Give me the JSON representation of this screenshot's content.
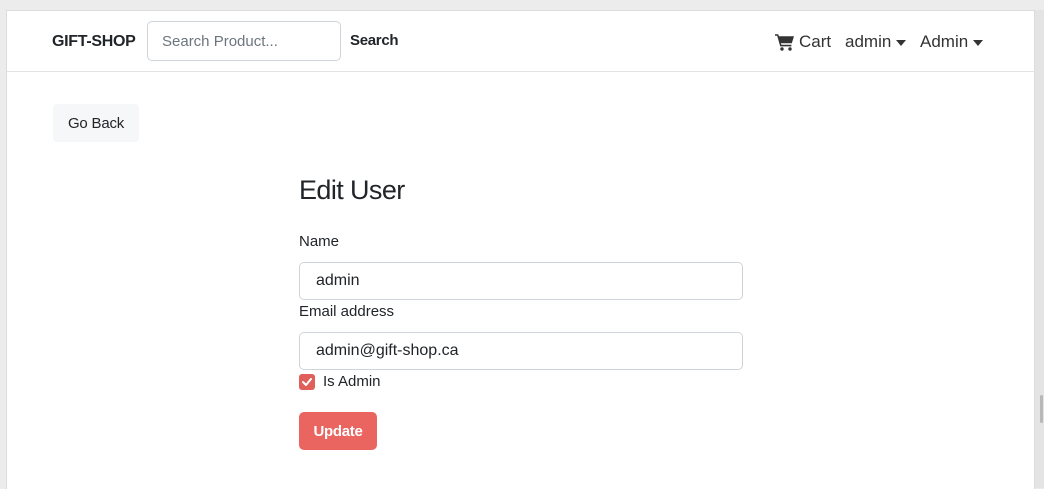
{
  "navbar": {
    "brand": "GIFT-SHOP",
    "search_placeholder": "Search Product...",
    "search_button": "Search",
    "cart_label": "Cart",
    "user_menu": "admin",
    "admin_menu": "Admin"
  },
  "go_back": "Go Back",
  "form": {
    "title": "Edit User",
    "name_label": "Name",
    "name_value": "admin",
    "email_label": "Email address",
    "email_value": "admin@gift-shop.ca",
    "is_admin_label": "Is Admin",
    "is_admin_checked": true,
    "update_button": "Update"
  },
  "colors": {
    "accent": "#ea6460",
    "checkbox": "#e05f5a"
  },
  "icons": {
    "cart": "shopping-cart-icon",
    "check": "check-icon",
    "caret": "caret-down-icon"
  }
}
